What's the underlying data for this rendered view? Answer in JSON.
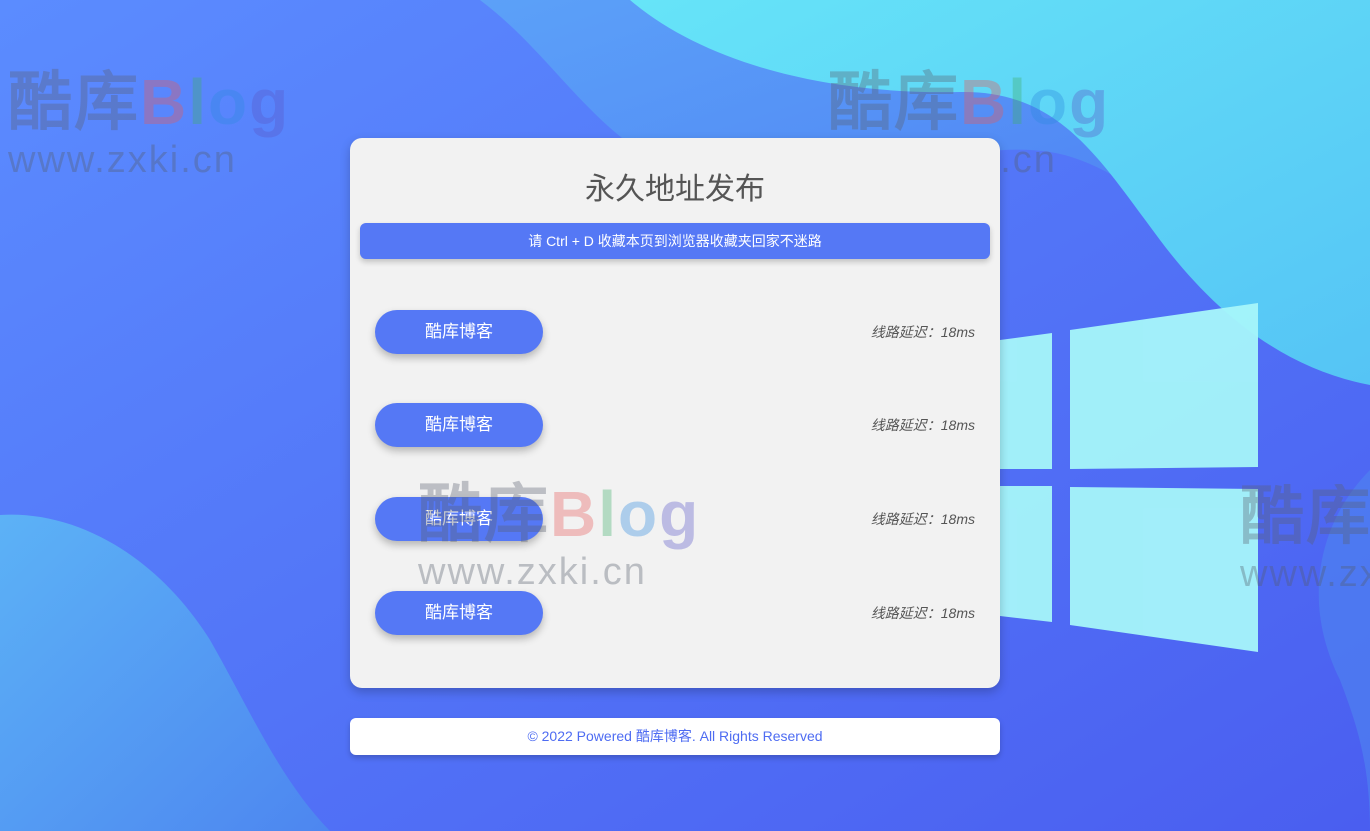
{
  "page": {
    "title": "永久地址发布",
    "notice": "请 Ctrl + D 收藏本页到浏览器收藏夹回家不迷路",
    "footer": "© 2022 Powered 酷库博客. All Rights Reserved"
  },
  "links": [
    {
      "label": "酷库博客",
      "latency": "线路延迟：18ms"
    },
    {
      "label": "酷库博客",
      "latency": "线路延迟：18ms"
    },
    {
      "label": "酷库博客",
      "latency": "线路延迟：18ms"
    },
    {
      "label": "酷库博客",
      "latency": "线路延迟：18ms"
    }
  ],
  "watermark": {
    "logo_cn": "酷库",
    "logo_b": "B",
    "logo_l": "l",
    "logo_o": "o",
    "logo_g": "g",
    "url": "www.zxki.cn"
  },
  "colors": {
    "background": "#4a66f0",
    "accent": "#5578f5",
    "card": "#f2f2f2",
    "footer_text": "#4e6cf2"
  },
  "icons": {
    "background_logo": "windows-logo-icon"
  }
}
